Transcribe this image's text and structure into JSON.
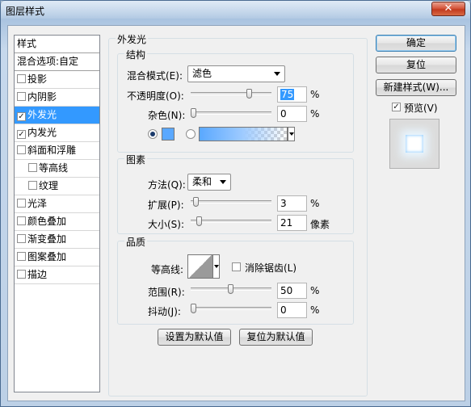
{
  "window": {
    "title": "图层样式",
    "close_label": "✕"
  },
  "sidebar": {
    "header": "样式",
    "blend_options": "混合选项:自定",
    "items": [
      {
        "label": "投影",
        "checked": false,
        "selected": false
      },
      {
        "label": "内阴影",
        "checked": false,
        "selected": false
      },
      {
        "label": "外发光",
        "checked": true,
        "selected": true
      },
      {
        "label": "内发光",
        "checked": true,
        "selected": false
      },
      {
        "label": "斜面和浮雕",
        "checked": false,
        "selected": false
      },
      {
        "label": "等高线",
        "checked": false,
        "selected": false
      },
      {
        "label": "纹理",
        "checked": false,
        "selected": false
      },
      {
        "label": "光泽",
        "checked": false,
        "selected": false
      },
      {
        "label": "颜色叠加",
        "checked": false,
        "selected": false
      },
      {
        "label": "渐变叠加",
        "checked": false,
        "selected": false
      },
      {
        "label": "图案叠加",
        "checked": false,
        "selected": false
      },
      {
        "label": "描边",
        "checked": false,
        "selected": false
      }
    ]
  },
  "panel": {
    "title": "外发光",
    "structure": {
      "title": "结构",
      "blend_mode_label": "混合模式(E):",
      "blend_mode_value": "滤色",
      "opacity_label": "不透明度(O):",
      "opacity_value": "75",
      "opacity_unit": "%",
      "opacity_level": 0.75,
      "noise_label": "杂色(N):",
      "noise_value": "0",
      "noise_unit": "%",
      "noise_level": 0,
      "color_swatch": "#5aa8ff"
    },
    "elements": {
      "title": "图素",
      "method_label": "方法(Q):",
      "method_value": "柔和",
      "spread_label": "扩展(P):",
      "spread_value": "3",
      "spread_unit": "%",
      "spread_level": 0.03,
      "size_label": "大小(S):",
      "size_value": "21",
      "size_unit": "像素",
      "size_level": 0.08
    },
    "quality": {
      "title": "品质",
      "contour_label": "等高线:",
      "antialias_label": "消除锯齿(L)",
      "antialias_checked": false,
      "range_label": "范围(R):",
      "range_value": "50",
      "range_unit": "%",
      "range_level": 0.5,
      "jitter_label": "抖动(J):",
      "jitter_value": "0",
      "jitter_unit": "%",
      "jitter_level": 0
    },
    "set_default": "设置为默认值",
    "reset_default": "复位为默认值"
  },
  "actions": {
    "ok": "确定",
    "reset": "复位",
    "new_style": "新建样式(W)...",
    "preview_label": "预览(V)",
    "preview_checked": true
  }
}
